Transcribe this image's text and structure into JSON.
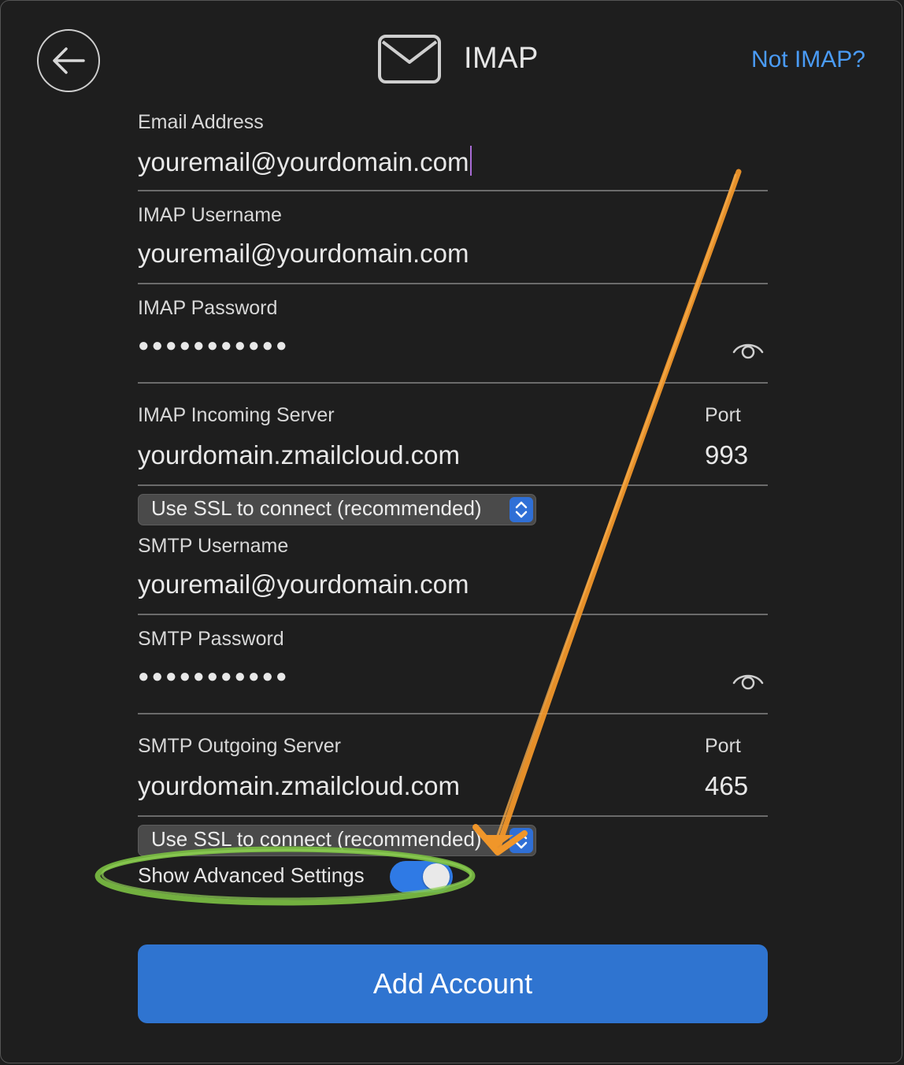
{
  "header": {
    "title": "IMAP",
    "not_imap_link": "Not IMAP?"
  },
  "email": {
    "label": "Email Address",
    "value": "youremail@yourdomain.com"
  },
  "imap_username": {
    "label": "IMAP Username",
    "value": "youremail@yourdomain.com"
  },
  "imap_password": {
    "label": "IMAP Password",
    "value": "●●●●●●●●●●●"
  },
  "imap_server": {
    "label": "IMAP Incoming Server",
    "value": "yourdomain.zmailcloud.com",
    "port_label": "Port",
    "port_value": "993"
  },
  "imap_ssl": {
    "selected": "Use SSL to connect (recommended)"
  },
  "smtp_username": {
    "label": "SMTP Username",
    "value": "youremail@yourdomain.com"
  },
  "smtp_password": {
    "label": "SMTP Password",
    "value": "●●●●●●●●●●●"
  },
  "smtp_server": {
    "label": "SMTP Outgoing Server",
    "value": "yourdomain.zmailcloud.com",
    "port_label": "Port",
    "port_value": "465"
  },
  "smtp_ssl": {
    "selected": "Use SSL to connect (recommended)"
  },
  "advanced": {
    "label": "Show Advanced Settings",
    "enabled": true
  },
  "actions": {
    "add_account": "Add Account"
  },
  "colors": {
    "accent": "#2f74d0",
    "link": "#4a9bf5",
    "annotation_arrow": "#f0962a",
    "annotation_circle": "#7bc043"
  },
  "icons": {
    "back": "arrow-left-icon",
    "mail": "envelope-icon",
    "reveal": "eye-icon",
    "stepper": "chevron-up-down-icon"
  }
}
